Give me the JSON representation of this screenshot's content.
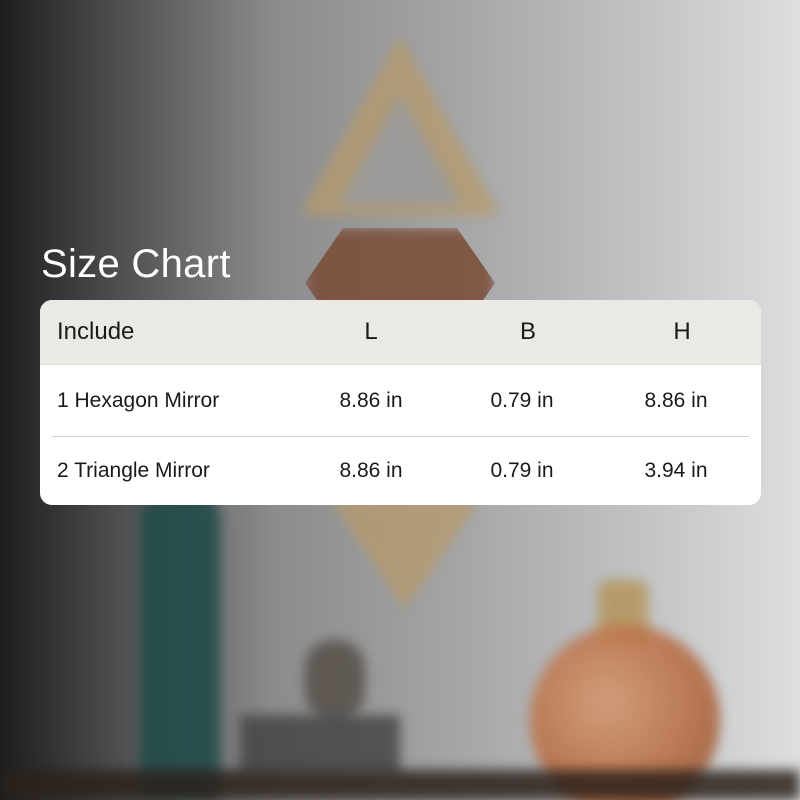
{
  "title": "Size Chart",
  "table": {
    "headers": [
      "Include",
      "L",
      "B",
      "H"
    ],
    "rows": [
      [
        "1 Hexagon Mirror",
        "8.86 in",
        "0.79 in",
        "8.86 in"
      ],
      [
        "2 Triangle Mirror",
        "8.86 in",
        "0.79 in",
        "3.94 in"
      ]
    ]
  },
  "colors": {
    "header_bg": "#ebe9e4",
    "card_bg": "#ffffff",
    "title_text": "#ffffff",
    "body_text": "#1a1a1a"
  }
}
